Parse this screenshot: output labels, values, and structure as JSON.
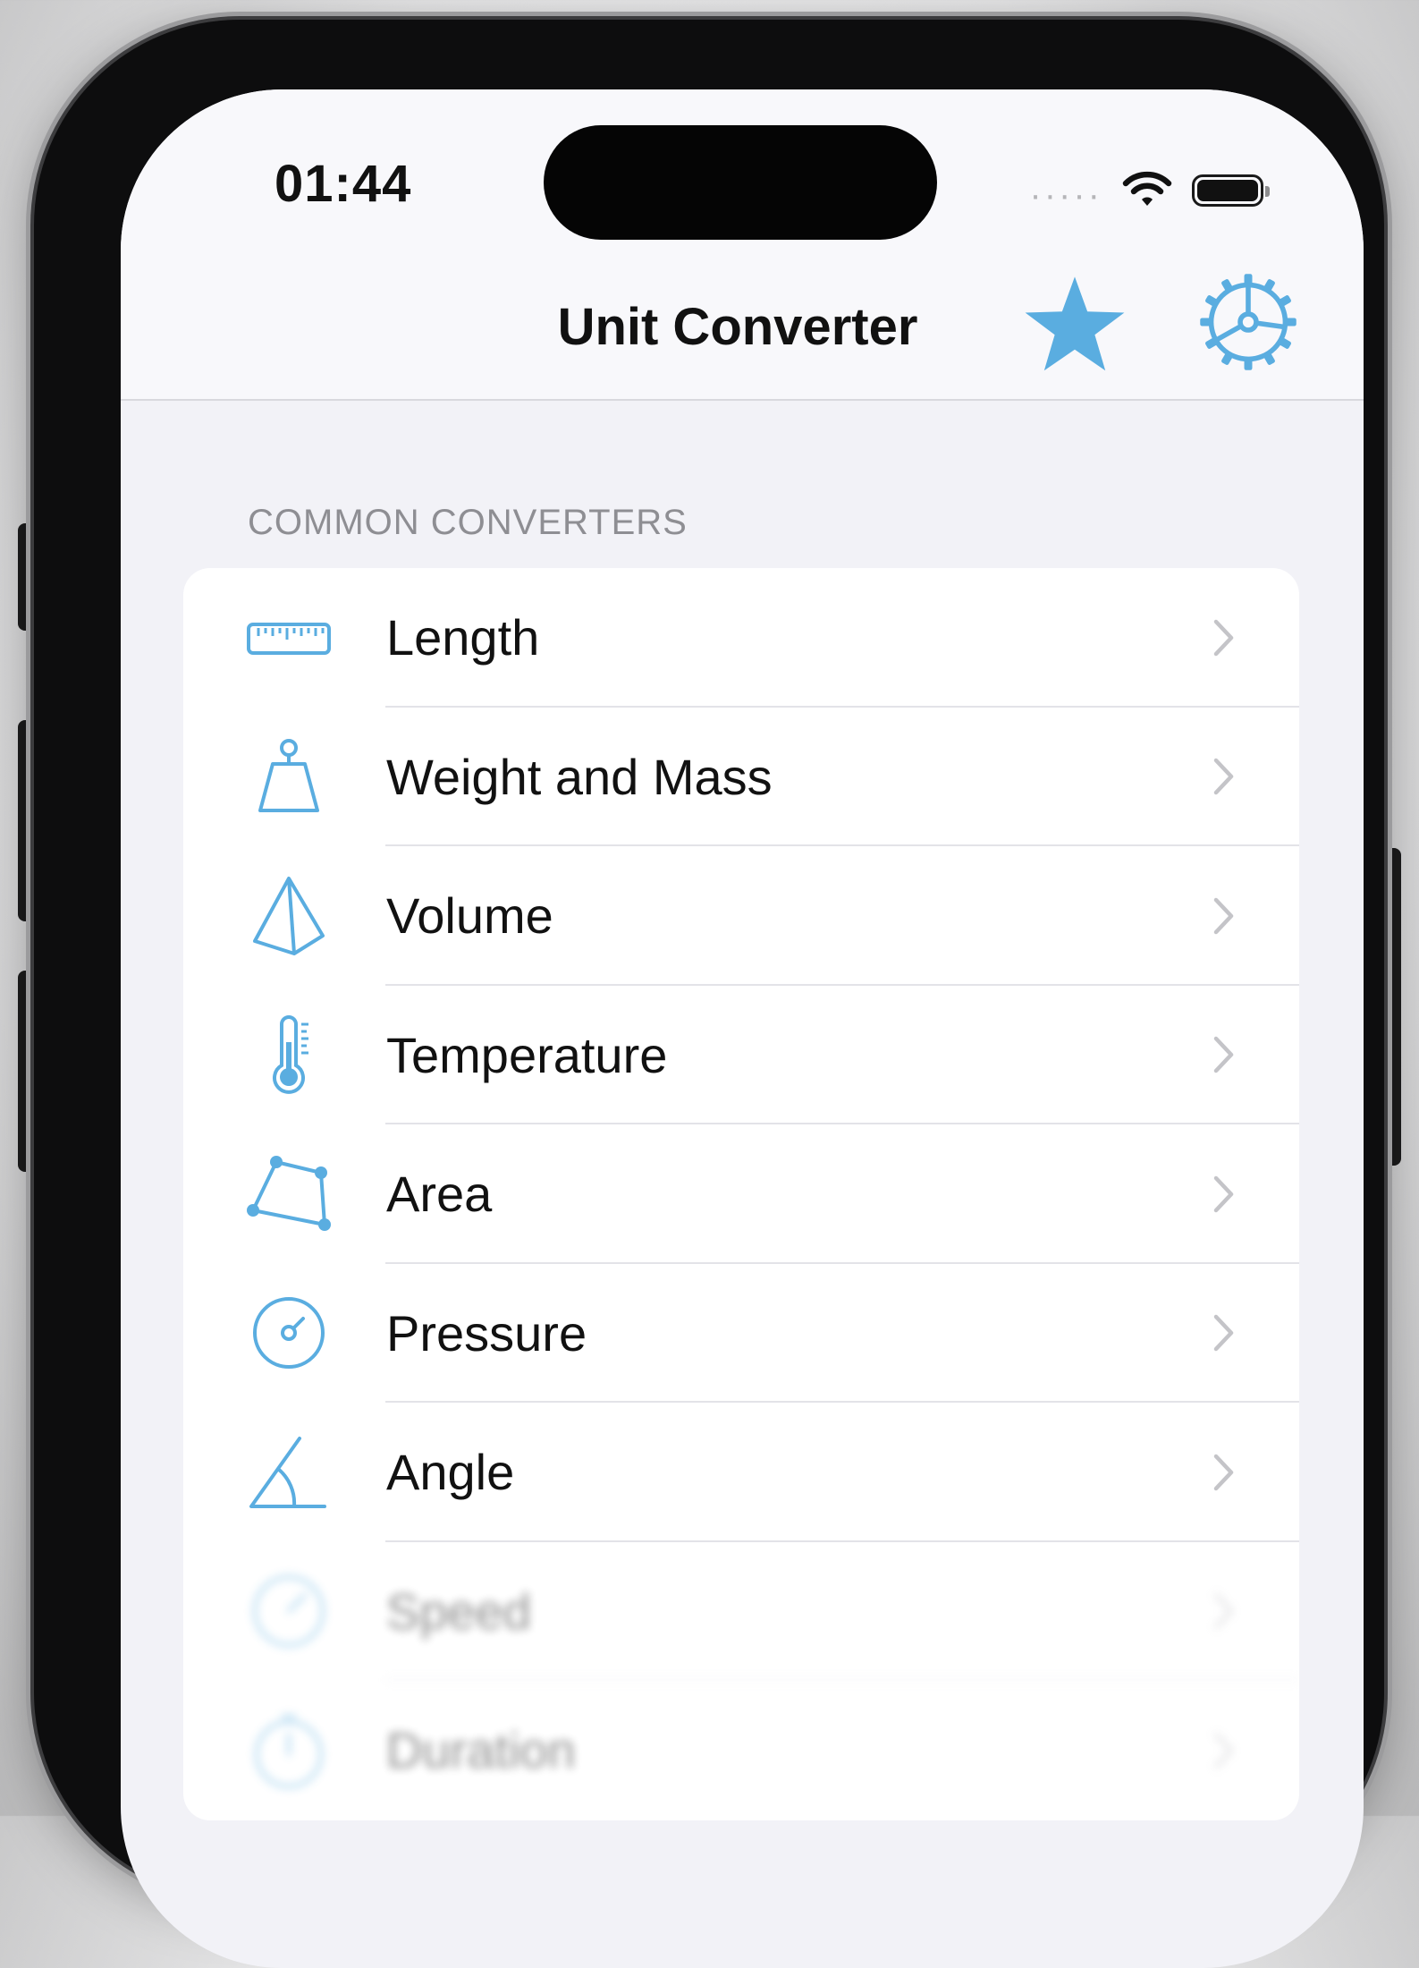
{
  "status_bar": {
    "time": "01:44",
    "signal": "·····",
    "icons": [
      "wifi-icon",
      "battery-icon"
    ]
  },
  "nav": {
    "title": "Unit Converter",
    "favorites_icon": "star-icon",
    "settings_icon": "gear-icon"
  },
  "section": {
    "header": "COMMON CONVERTERS"
  },
  "converters": [
    {
      "label": "Length",
      "icon": "ruler-icon"
    },
    {
      "label": "Weight and Mass",
      "icon": "scale-weight-icon"
    },
    {
      "label": "Volume",
      "icon": "pyramid-icon"
    },
    {
      "label": "Temperature",
      "icon": "thermometer-icon"
    },
    {
      "label": "Area",
      "icon": "skew-square-icon"
    },
    {
      "label": "Pressure",
      "icon": "gauge-icon"
    },
    {
      "label": "Angle",
      "icon": "angle-icon"
    },
    {
      "label": "Speed",
      "icon": "speedometer-icon"
    },
    {
      "label": "Duration",
      "icon": "stopwatch-icon"
    }
  ],
  "colors": {
    "accent": "#5aade0",
    "background": "#f2f2f7",
    "card": "#ffffff",
    "secondary_text": "#8e8e93"
  }
}
